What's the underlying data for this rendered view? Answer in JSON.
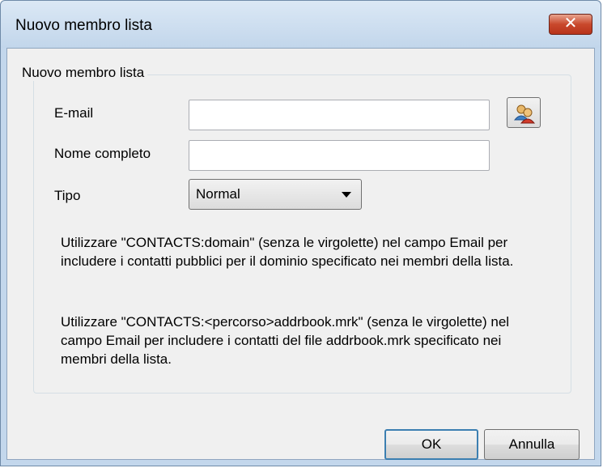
{
  "dialog": {
    "title": "Nuovo membro lista",
    "close_label": "✕"
  },
  "group": {
    "legend": "Nuovo membro lista"
  },
  "form": {
    "email_label": "E-mail",
    "email_value": "",
    "address_book_icon": "address-book-icon",
    "fullname_label": "Nome completo",
    "fullname_value": "",
    "type_label": "Tipo",
    "type_value": "Normal"
  },
  "help": {
    "para1": "Utilizzare \"CONTACTS:domain\" (senza le virgolette) nel campo Email per includere i contatti pubblici per il dominio specificato nei membri della lista.",
    "para2": "Utilizzare \"CONTACTS:<percorso>addrbook.mrk\" (senza le virgolette) nel campo Email per includere i contatti del file addrbook.mrk specificato nei membri della lista."
  },
  "buttons": {
    "ok": "OK",
    "cancel": "Annulla"
  }
}
